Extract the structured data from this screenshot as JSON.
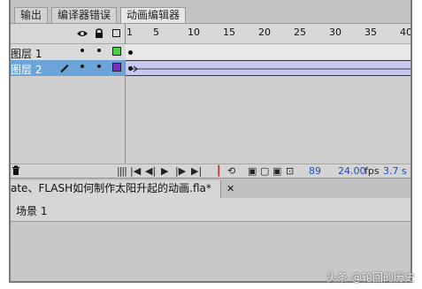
{
  "top_tabs": [
    "输出",
    "编译器错误",
    "动画编辑器"
  ],
  "ruler": {
    "labels": [
      "1",
      "5",
      "10",
      "15",
      "20",
      "25",
      "30",
      "35",
      "40"
    ]
  },
  "header_icons": [
    "eye-icon",
    "lock-icon",
    "outline-icon"
  ],
  "layers": [
    {
      "name": "图层 1",
      "color": "#44d244",
      "selected": false
    },
    {
      "name": "图层 2",
      "color": "#7a2fc0",
      "selected": true
    }
  ],
  "colors": {
    "selected_row": "#6aa4d8",
    "frame_span": "#c8c8f0"
  },
  "controls": {
    "current_frame": "89",
    "fps_value": "24.00",
    "fps_unit": "fps",
    "seconds": "3.7 s"
  },
  "document": {
    "tab_title": "ate、FLASH如何制作太阳升起的动画.fla*",
    "close": "✕"
  },
  "scene": {
    "label": "场景 1"
  },
  "watermark": "头条 @轮回的历史"
}
